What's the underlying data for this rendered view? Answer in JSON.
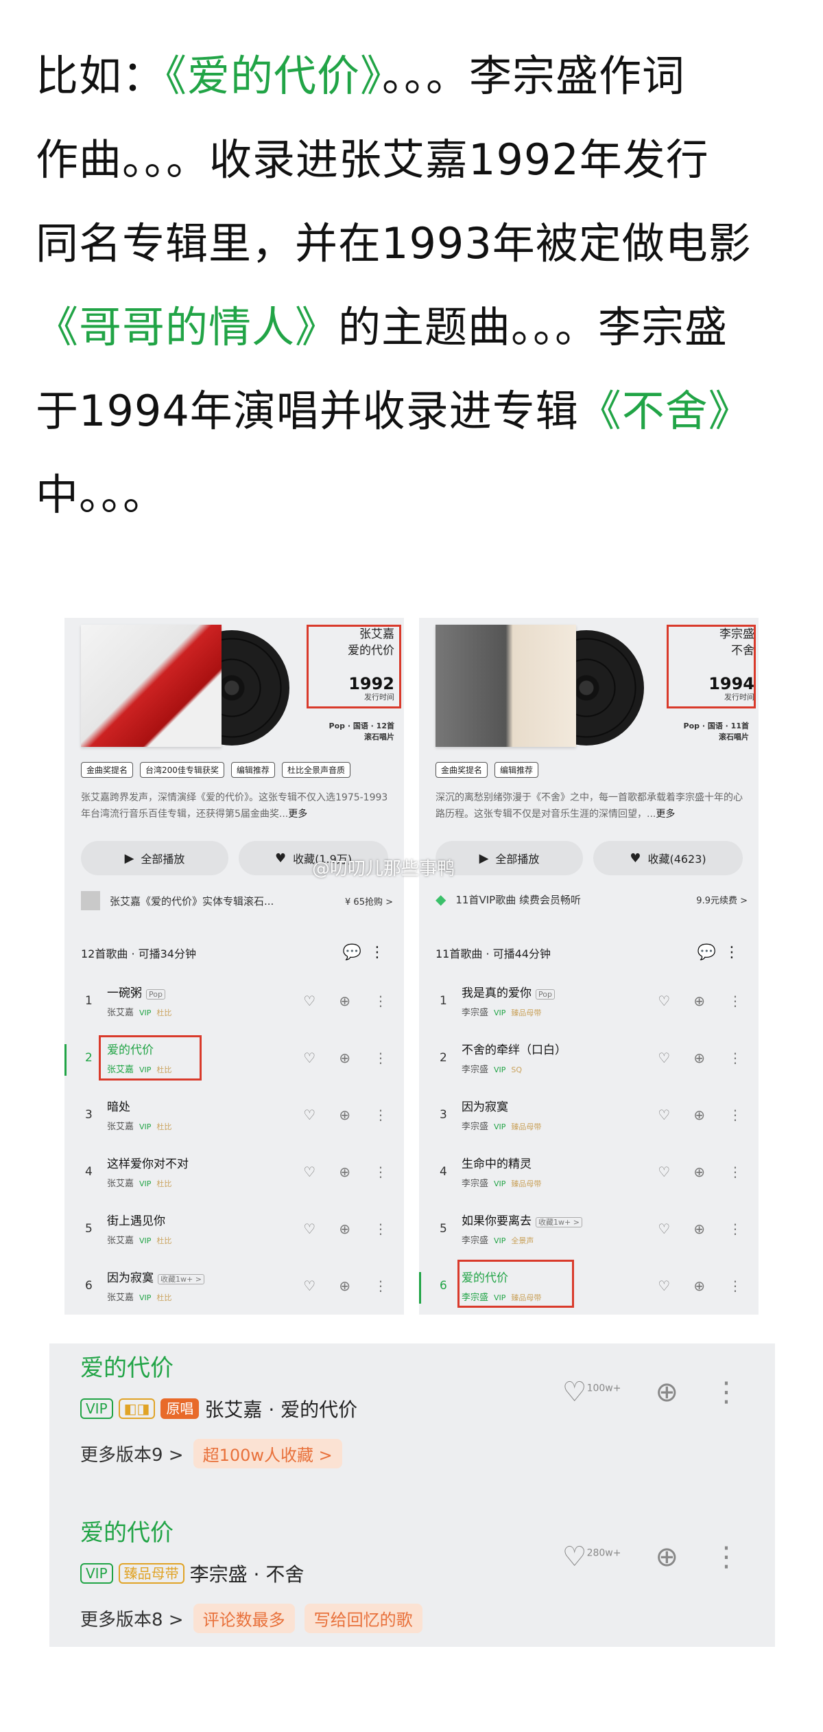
{
  "article": {
    "l1_a": "比如：",
    "l1_g": "《爱的代价》",
    "l1_b": "。。。李宗盛作词",
    "l2": "作曲。。。收录进张艾嘉1992年发行",
    "l3": "同名专辑里，并在1993年被定做电影",
    "l4_g": "《哥哥的情人》",
    "l4_b": "的主题曲。。。李宗盛",
    "l5_a": "于1994年演唱并收录进专辑",
    "l5_g": "《不舍》",
    "l6": "中。。。"
  },
  "left": {
    "artist": "张艾嘉",
    "album": "爱的代价",
    "year": "1992",
    "year_label": "发行时间",
    "meta1": "Pop · 国语 · 12首",
    "meta2": "滚石唱片",
    "tags": [
      "金曲奖提名",
      "台湾200佳专辑获奖",
      "编辑推荐",
      "杜比全景声音质"
    ],
    "desc": "张艾嘉跨界发声，深情演绎《爱的代价》。这张专辑不仅入选1975-1993年台湾流行音乐百佳专辑，还获得第5届金曲奖...",
    "desc_more": "更多",
    "play_all": "全部播放",
    "collect": "收藏(1.9万)",
    "ad": "张艾嘉《爱的代价》实体专辑滚石...",
    "ad_right": "¥ 65抢购 >",
    "count": "12首歌曲 · 可播34分钟",
    "songs": [
      {
        "n": "1",
        "t": "一碗粥",
        "pop": "Pop",
        "a": "张艾嘉",
        "v": "VIP",
        "q": "杜比"
      },
      {
        "n": "2",
        "t": "爱的代价",
        "pop": "",
        "a": "张艾嘉",
        "v": "VIP",
        "q": "杜比"
      },
      {
        "n": "3",
        "t": "暗处",
        "pop": "",
        "a": "张艾嘉",
        "v": "VIP",
        "q": "杜比"
      },
      {
        "n": "4",
        "t": "这样爱你对不对",
        "pop": "",
        "a": "张艾嘉",
        "v": "VIP",
        "q": "杜比"
      },
      {
        "n": "5",
        "t": "街上遇见你",
        "pop": "",
        "a": "张艾嘉",
        "v": "VIP",
        "q": "杜比"
      },
      {
        "n": "6",
        "t": "因为寂寞",
        "pop": "收藏1w+ >",
        "a": "张艾嘉",
        "v": "VIP",
        "q": "杜比"
      }
    ]
  },
  "right": {
    "artist": "李宗盛",
    "album": "不舍",
    "year": "1994",
    "year_label": "发行时间",
    "meta1": "Pop · 国语 · 11首",
    "meta2": "滚石唱片",
    "tags": [
      "金曲奖提名",
      "编辑推荐"
    ],
    "desc": "深沉的离愁别绪弥漫于《不舍》之中，每一首歌都承载着李宗盛十年的心路历程。这张专辑不仅是对音乐生涯的深情回望，...",
    "desc_more": "更多",
    "play_all": "全部播放",
    "collect": "收藏(4623)",
    "ad": "11首VIP歌曲 续费会员畅听",
    "ad_right": "9.9元续费 >",
    "count": "11首歌曲 · 可播44分钟",
    "songs": [
      {
        "n": "1",
        "t": "我是真的爱你",
        "pop": "Pop",
        "a": "李宗盛",
        "v": "VIP",
        "q": "臻品母带"
      },
      {
        "n": "2",
        "t": "不舍的牵绊（口白）",
        "pop": "",
        "a": "李宗盛",
        "v": "VIP",
        "q": "SQ"
      },
      {
        "n": "3",
        "t": "因为寂寞",
        "pop": "",
        "a": "李宗盛",
        "v": "VIP",
        "q": "臻品母带"
      },
      {
        "n": "4",
        "t": "生命中的精灵",
        "pop": "",
        "a": "李宗盛",
        "v": "VIP",
        "q": "臻品母带"
      },
      {
        "n": "5",
        "t": "如果你要离去",
        "pop": "收藏1w+ >",
        "a": "李宗盛",
        "v": "VIP",
        "q": "全景声"
      },
      {
        "n": "6",
        "t": "爱的代价",
        "pop": "",
        "a": "李宗盛",
        "v": "VIP",
        "q": "臻品母带"
      }
    ]
  },
  "watermark": "@叨叨儿那些事鸭",
  "results": [
    {
      "title": "爱的代价",
      "badges": [
        "VIP",
        "原唱"
      ],
      "artist": "张艾嘉 · 爱的代价",
      "more": "更多版本9 >",
      "pills": [
        "超100w人收藏 >"
      ],
      "likes": "100w+"
    },
    {
      "title": "爱的代价",
      "badges": [
        "VIP",
        "臻品母带"
      ],
      "artist": "李宗盛 · 不舍",
      "more": "更多版本8 >",
      "pills": [
        "评论数最多",
        "写给回忆的歌"
      ],
      "likes": "280w+"
    }
  ],
  "colors": {
    "accent": "#21a446",
    "highlight": "#d93a2b",
    "pill_text": "#e8703a"
  }
}
